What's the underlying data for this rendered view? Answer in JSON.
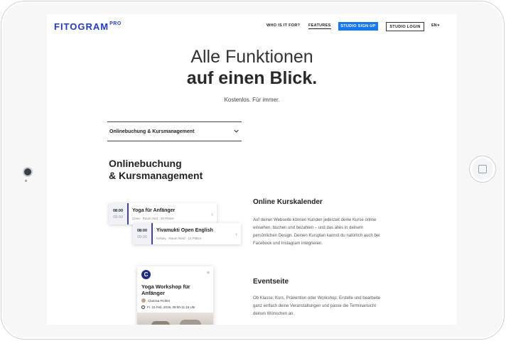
{
  "header": {
    "logo": "FITOGRAM",
    "logo_sup": "PRO",
    "nav": [
      "WHO IS IT FOR?",
      "FEATURES"
    ],
    "signup_label": "STUDIO SIGN-UP",
    "login_label": "STUDIO LOGIN",
    "language": "EN"
  },
  "hero": {
    "title_line1": "Alle Funktionen",
    "title_line2": "auf einen Blick.",
    "subtitle": "Kostenlos. Für immer."
  },
  "dropdown": {
    "selected": "Onlinebuchung & Kursmanagement"
  },
  "section": {
    "heading_line1": "Onlinebuchung",
    "heading_line2": "& Kursmanagement"
  },
  "features": [
    {
      "title": "Online Kurskalender",
      "description": "Auf deiner Webseite können Kunden jederzeit deine Kurse online einsehen, buchen und bezahlen – und das alles in deinem persönlichen Design. Deinen Kursplan kannst du natürlich auch bei Facebook und Instagram integrieren."
    },
    {
      "title": "Eventseite",
      "description": "Ob Klasse, Kurs, Prävention oder Workshop. Erstelle und bearbeite ganz einfach deine Veranstaltungen und passe die Terminansicht deinen Wünschen an."
    }
  ],
  "cards": [
    {
      "time_start": "08:00",
      "time_end": "09:00",
      "title": "Yoga für Anfänger",
      "meta": "Clara · Raum Süd · 20 Plätze"
    },
    {
      "time_start": "08:00",
      "time_end": "09:00",
      "title": "Yivamukti Open English",
      "meta": "Kelsey · Raum Nord · 15 Plätze"
    }
  ],
  "phone": {
    "logo_glyph": "C",
    "title": "Yoga Workshop für Anfänger",
    "instructor": "Clarissa Pichler",
    "date": "Fr. 15 Feb. 2019, 09:00-11:15 Uhr"
  },
  "icons": {
    "dropdown_chevron": "chevron-down-icon",
    "card_arrow": "chevron-right-icon",
    "phone_menu": "menu-icon"
  },
  "colors": {
    "brand": "#1f3ad6",
    "signup_button": "#1578f5",
    "card_accent": "#3b3fcf"
  }
}
